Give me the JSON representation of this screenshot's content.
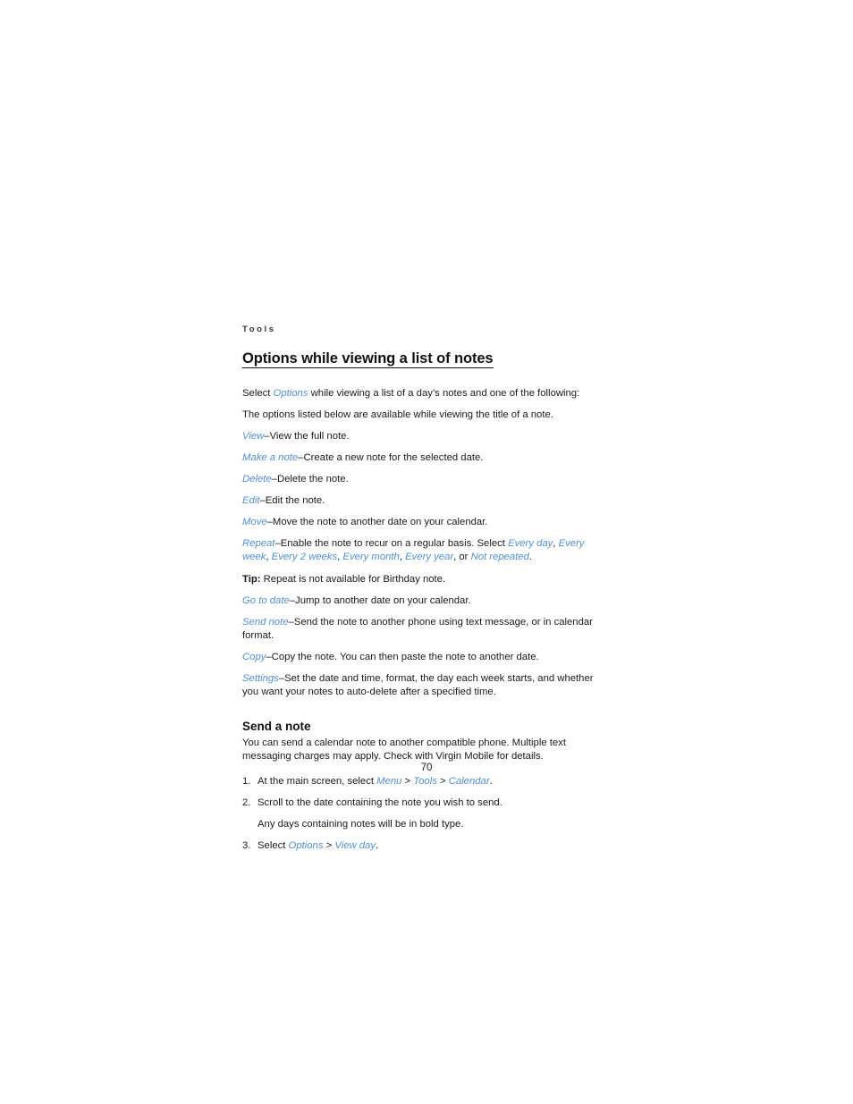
{
  "page": {
    "running_head": "Tools",
    "page_number": "70",
    "link_color": "#4e8fd6",
    "text_color": "#1a1a1a"
  },
  "section": {
    "title": "Options while viewing a list of notes",
    "intro_1_a": "Select ",
    "intro_1_ui": "Options",
    "intro_1_b": " while viewing a list of a day’s notes and one of the following:",
    "intro_2": "The options listed below are available while viewing the title of a note."
  },
  "options": [
    {
      "term": "View",
      "desc": "–View the full note."
    },
    {
      "term": "Make a note",
      "desc": "–Create a new note for the selected date."
    },
    {
      "term": "Delete",
      "desc": "–Delete the note."
    },
    {
      "term": "Edit",
      "desc": "–Edit the note."
    },
    {
      "term": "Move",
      "desc": "–Move the note to another date on your calendar."
    }
  ],
  "repeat": {
    "term": "Repeat",
    "desc_a": "–Enable the note to recur on a regular basis. Select ",
    "values": [
      "Every day",
      "Every week",
      "Every 2 weeks",
      "Every month",
      "Every year",
      "Not repeated"
    ],
    "value_sep": ", ",
    "value_last_sep": ", or ",
    "desc_end": "."
  },
  "tip": {
    "label": "Tip:",
    "text": " Repeat is not available for Birthday note."
  },
  "options_2": [
    {
      "term": "Go to date",
      "desc": "–Jump to another date on your calendar."
    },
    {
      "term": "Send note",
      "desc": "–Send the note to another phone using text message, or in calendar format."
    },
    {
      "term": "Copy",
      "desc": "–Copy the note. You can then paste the note to another date."
    },
    {
      "term": "Settings",
      "desc": "–Set the date and time, format, the day each week starts, and whether you want your notes to auto-delete after a specified time."
    }
  ],
  "send_a_note": {
    "title": "Send a note",
    "intro": "You can send a calendar note to another compatible phone. Multiple text messaging charges may apply. Check with Virgin Mobile for details.",
    "steps": [
      {
        "number": "1.",
        "text_a": "At the main screen, select ",
        "path": [
          "Menu",
          "Tools",
          "Calendar"
        ],
        "path_sep": " > ",
        "text_b": "."
      },
      {
        "number": "2.",
        "text_a": "Scroll to the date containing the note you wish to send.",
        "substep": "Any days containing notes will be in bold type."
      },
      {
        "number": "3.",
        "text_a": "Select ",
        "path": [
          "Options",
          "View day"
        ],
        "path_sep": " > ",
        "text_b": "."
      }
    ]
  }
}
